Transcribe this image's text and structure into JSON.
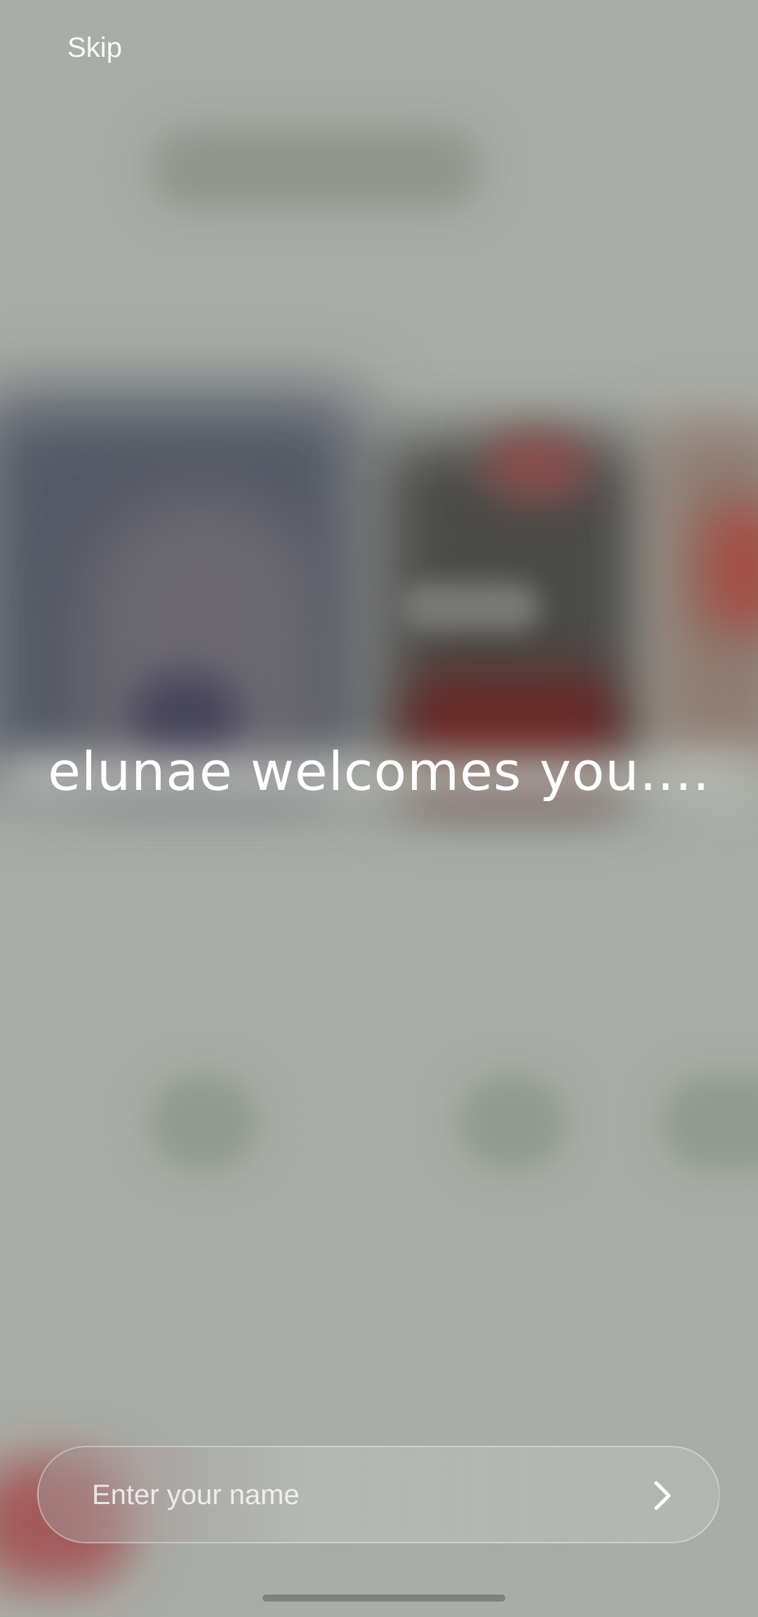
{
  "top_bar": {
    "skip_label": "Skip"
  },
  "welcome": {
    "message": "elunae welcomes you...."
  },
  "name_entry": {
    "value": "",
    "placeholder": "Enter your name",
    "submit_icon": "chevron-right-icon"
  },
  "colors": {
    "background": "#a9ada7",
    "text": "#ffffff"
  }
}
